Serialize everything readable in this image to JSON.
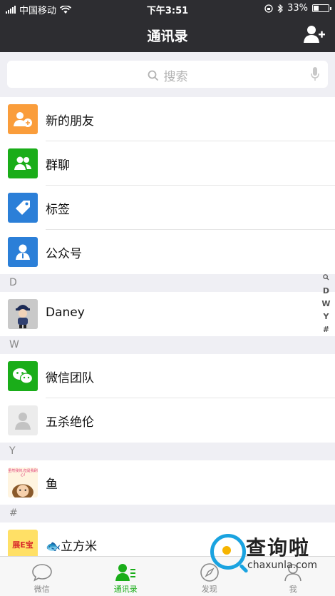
{
  "status": {
    "carrier": "中国移动",
    "time": "下午3:51",
    "battery_text": "33%",
    "battery_level": 0.33
  },
  "nav": {
    "title": "通讯录",
    "add_icon": "add-contact-icon"
  },
  "search": {
    "placeholder": "搜索"
  },
  "features": [
    {
      "label": "新的朋友",
      "icon": "new-friends-icon",
      "color": "#fa9d3b"
    },
    {
      "label": "群聊",
      "icon": "group-chat-icon",
      "color": "#1aad19"
    },
    {
      "label": "标签",
      "icon": "tag-icon",
      "color": "#2b7fd8"
    },
    {
      "label": "公众号",
      "icon": "official-account-icon",
      "color": "#2b7fd8"
    }
  ],
  "sections": [
    {
      "letter": "D",
      "contacts": [
        {
          "name": "Daney"
        }
      ]
    },
    {
      "letter": "W",
      "contacts": [
        {
          "name": "微信团队"
        },
        {
          "name": "五杀绝伦"
        }
      ]
    },
    {
      "letter": "Y",
      "contacts": [
        {
          "name": "鱼"
        }
      ]
    },
    {
      "letter": "#",
      "contacts": [
        {
          "name": "🐟立方米"
        }
      ]
    }
  ],
  "index_letters": [
    "D",
    "W",
    "Y",
    "#"
  ],
  "tabs": [
    {
      "label": "微信",
      "active": false
    },
    {
      "label": "通讯录",
      "active": true
    },
    {
      "label": "发现",
      "active": false
    },
    {
      "label": "我",
      "active": false
    }
  ],
  "avatar_texts": {
    "yu_top": "虽然我帅,但是我刷心!",
    "badge": "展E宝"
  },
  "watermark": {
    "title": "查询啦",
    "url": "chaxunla.com"
  }
}
